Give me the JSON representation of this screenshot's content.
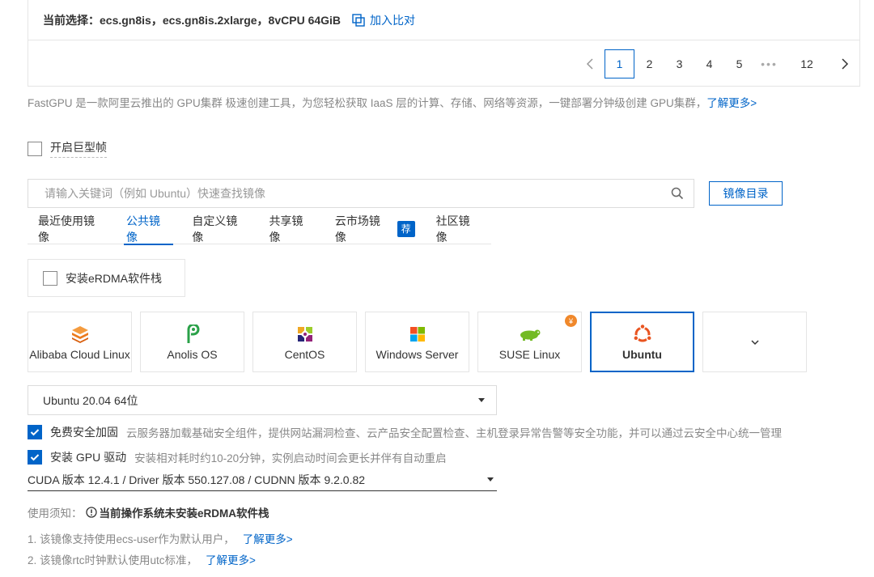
{
  "selection": {
    "text": "当前选择：ecs.gn8is，ecs.gn8is.2xlarge，8vCPU 64GiB",
    "compare_label": "加入比对"
  },
  "pagination": {
    "pages": [
      "1",
      "2",
      "3",
      "4",
      "5"
    ],
    "ellipsis": "•••",
    "last": "12",
    "current": "1"
  },
  "description": {
    "text": "FastGPU 是一款阿里云推出的 GPU集群 极速创建工具，为您轻松获取 IaaS 层的计算、存储、网络等资源，一键部署分钟级创建 GPU集群，",
    "link": "了解更多>"
  },
  "jumbo_frame": {
    "label": "开启巨型帧",
    "checked": false
  },
  "image_search": {
    "placeholder": "请输入关键词（例如 Ubuntu）快速查找镜像",
    "catalog_button": "镜像目录"
  },
  "tabs": [
    {
      "label": "最近使用镜像"
    },
    {
      "label": "公共镜像"
    },
    {
      "label": "自定义镜像"
    },
    {
      "label": "共享镜像"
    },
    {
      "label": "云市场镜像",
      "badge": "荐"
    },
    {
      "label": "社区镜像"
    }
  ],
  "active_tab": "公共镜像",
  "erdma": {
    "label": "安装eRDMA软件栈",
    "checked": false
  },
  "os_options": [
    {
      "name": "Alibaba Cloud Linux",
      "icon": "alibaba-cloud-icon"
    },
    {
      "name": "Anolis OS",
      "icon": "anolis-icon"
    },
    {
      "name": "CentOS",
      "icon": "centos-icon"
    },
    {
      "name": "Windows Server",
      "icon": "windows-icon"
    },
    {
      "name": "SUSE Linux",
      "icon": "suse-icon",
      "badge": "¥"
    },
    {
      "name": "Ubuntu",
      "icon": "ubuntu-icon"
    }
  ],
  "selected_os": "Ubuntu",
  "os_version": "Ubuntu 20.04 64位",
  "security_hardening": {
    "label": "免费安全加固",
    "description": "云服务器加载基础安全组件，提供网站漏洞检查、云产品安全配置检查、主机登录异常告警等安全功能，并可以通过云安全中心统一管理",
    "checked": true
  },
  "gpu_driver": {
    "label": "安装 GPU 驱动",
    "description": "安装相对耗时约10-20分钟，实例启动时间会更长并伴有自动重启",
    "checked": true
  },
  "cuda_version": "CUDA 版本 12.4.1 / Driver 版本 550.127.08 / CUDNN 版本 9.2.0.82",
  "notice": {
    "prefix": "使用须知：",
    "warning": "当前操作系统未安装eRDMA软件栈"
  },
  "notes": [
    {
      "text": "1. 该镜像支持使用ecs-user作为默认用户，",
      "link": "了解更多>"
    },
    {
      "text": "2. 该镜像rtc时钟默认使用utc标准，",
      "link": "了解更多>"
    }
  ],
  "colors": {
    "accent": "#0064c8",
    "paid_badge": "#f0882b",
    "anolis_green": "#2aa148",
    "ubuntu_orange": "#e95420"
  }
}
